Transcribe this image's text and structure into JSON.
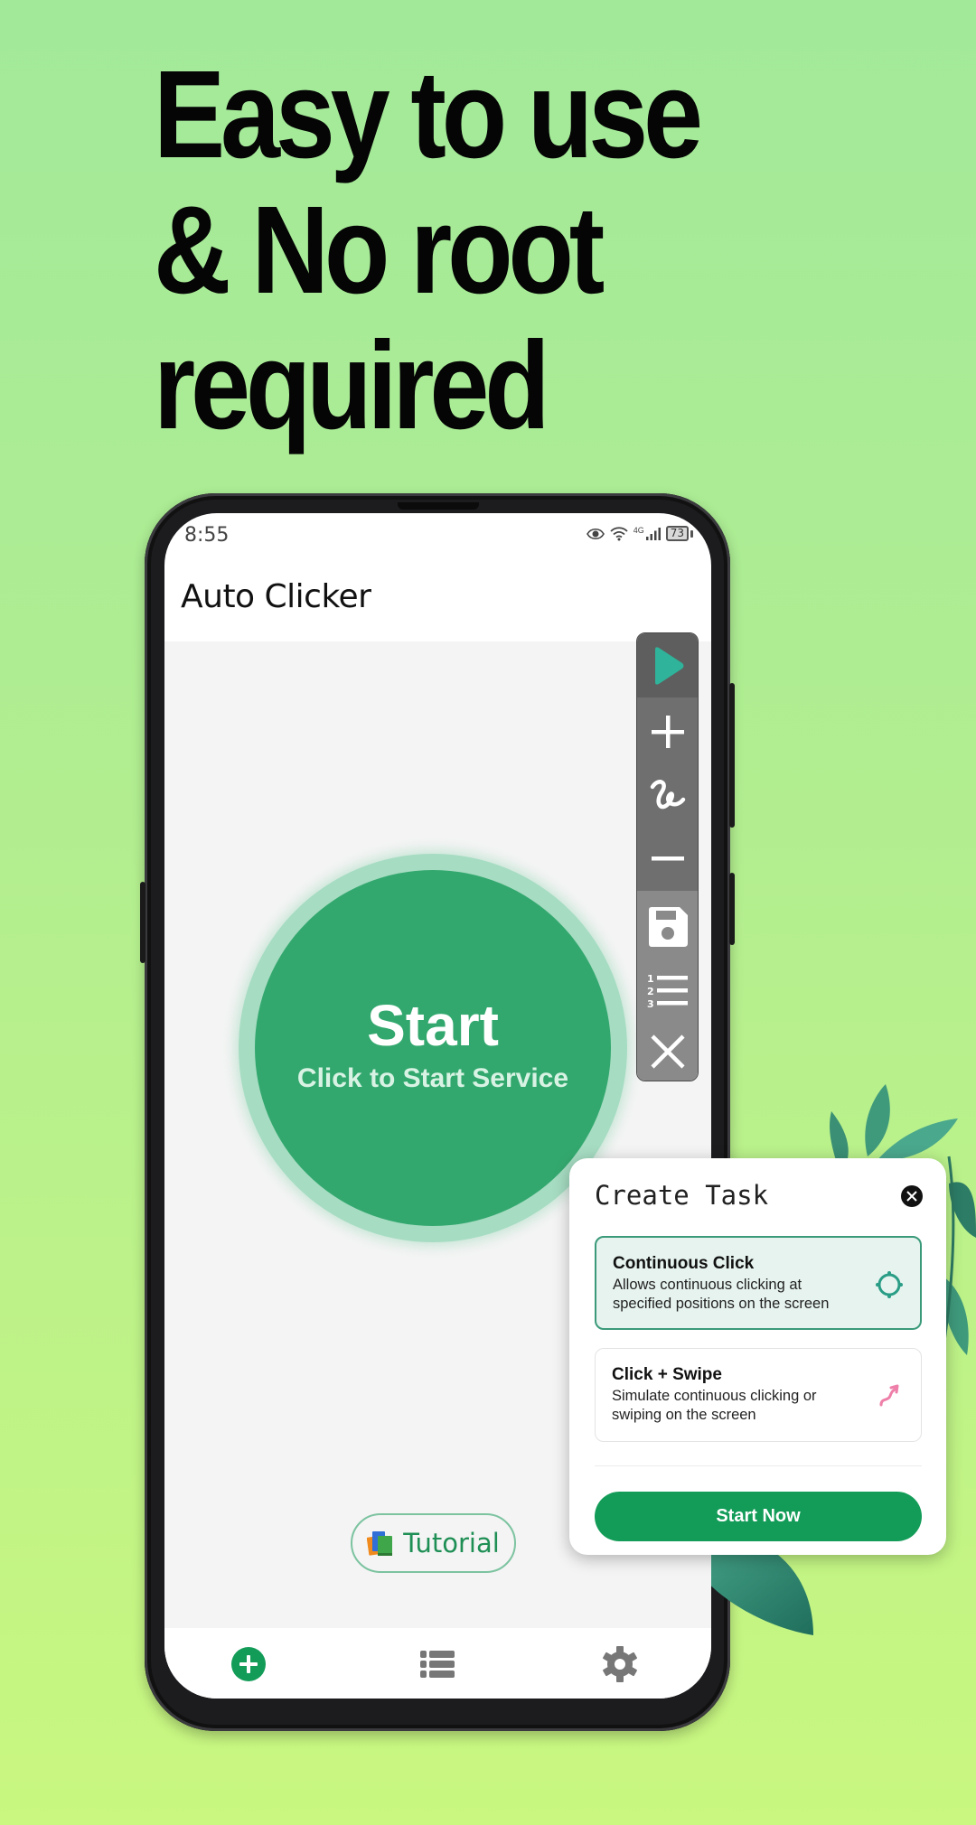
{
  "headline": {
    "lines": [
      "Easy to use",
      "& No root",
      "required"
    ]
  },
  "status_bar": {
    "time": "8:55",
    "icons": [
      "eye-comfort-icon",
      "wifi-icon",
      "4g-icon",
      "signal-icon",
      "battery-icon"
    ],
    "network_label": "4G",
    "battery_level": "73"
  },
  "app": {
    "title": "Auto Clicker"
  },
  "start_button": {
    "title": "Start",
    "subtitle": "Click to Start Service",
    "color": "#33a86e"
  },
  "tutorial_button": {
    "label": "Tutorial",
    "icon": "books-icon"
  },
  "floating_toolbar": {
    "buttons": [
      {
        "name": "play",
        "icon": "play-icon"
      },
      {
        "name": "add-point",
        "icon": "plus-icon"
      },
      {
        "name": "add-swipe",
        "icon": "swipe-path-icon"
      },
      {
        "name": "remove-point",
        "icon": "minus-icon"
      },
      {
        "name": "save",
        "icon": "save-icon"
      },
      {
        "name": "numbered-list",
        "icon": "numbered-list-icon"
      },
      {
        "name": "close",
        "icon": "close-icon"
      }
    ],
    "accent": "#2fb39a"
  },
  "dialog": {
    "title": "Create Task",
    "options": [
      {
        "title": "Continuous Click",
        "description": "Allows continuous clicking at specified positions on the screen",
        "icon": "crosshair-icon",
        "selected": true
      },
      {
        "title": "Click + Swipe",
        "description": "Simulate continuous clicking or swiping on the screen",
        "icon": "swipe-arrow-icon",
        "selected": false
      }
    ],
    "primary_button": "Start Now",
    "primary_color": "#139c58"
  },
  "bottom_nav": {
    "items": [
      {
        "name": "create",
        "icon": "add-circle-icon",
        "active": true
      },
      {
        "name": "task-list",
        "icon": "list-icon",
        "active": false
      },
      {
        "name": "settings",
        "icon": "gear-icon",
        "active": false
      }
    ]
  }
}
